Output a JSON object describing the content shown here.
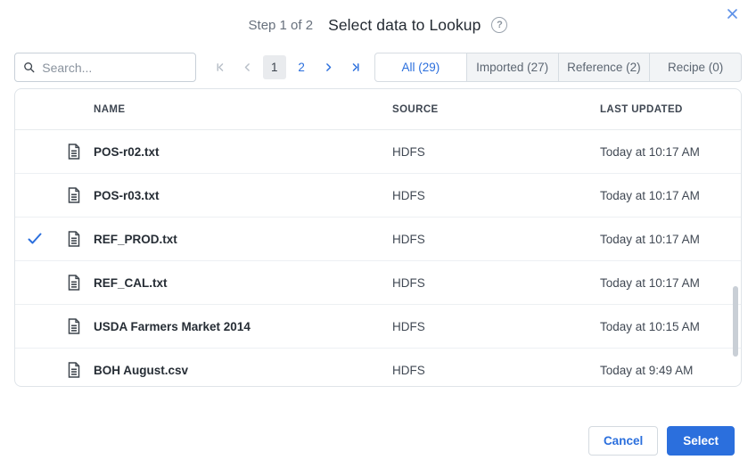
{
  "dialog": {
    "step_label": "Step 1 of 2",
    "title": "Select data to Lookup",
    "help_glyph": "?"
  },
  "search": {
    "placeholder": "Search..."
  },
  "pagination": {
    "pages": [
      {
        "label": "1",
        "current": true
      },
      {
        "label": "2",
        "current": false
      }
    ],
    "first_disabled": true,
    "prev_disabled": true
  },
  "tabs": [
    {
      "label": "All (29)",
      "active": true
    },
    {
      "label": "Imported (27)",
      "active": false
    },
    {
      "label": "Reference (2)",
      "active": false
    },
    {
      "label": "Recipe (0)",
      "active": false
    }
  ],
  "table": {
    "columns": {
      "name": "NAME",
      "source": "SOURCE",
      "last_updated": "LAST UPDATED"
    },
    "rows": [
      {
        "name": "POS-r02.txt",
        "source": "HDFS",
        "last_updated": "Today at 10:17 AM",
        "selected": false
      },
      {
        "name": "POS-r03.txt",
        "source": "HDFS",
        "last_updated": "Today at 10:17 AM",
        "selected": false
      },
      {
        "name": "REF_PROD.txt",
        "source": "HDFS",
        "last_updated": "Today at 10:17 AM",
        "selected": true
      },
      {
        "name": "REF_CAL.txt",
        "source": "HDFS",
        "last_updated": "Today at 10:17 AM",
        "selected": false
      },
      {
        "name": "USDA Farmers Market 2014",
        "source": "HDFS",
        "last_updated": "Today at 10:15 AM",
        "selected": false
      },
      {
        "name": "BOH August.csv",
        "source": "HDFS",
        "last_updated": "Today at 9:49 AM",
        "selected": false
      }
    ]
  },
  "footer": {
    "cancel_label": "Cancel",
    "select_label": "Select"
  },
  "icons": {
    "search": "magnifier",
    "file": "data-file-document",
    "check": "checkmark",
    "first_page": "bar-chevron-left",
    "prev_page": "chevron-left",
    "next_page": "chevron-right",
    "last_page": "chevron-right-bar",
    "close": "x-mark",
    "help": "question-circle"
  },
  "colors": {
    "accent_blue": "#2b6fdd",
    "close_blue": "#5f92e8",
    "disabled_gray": "#b8bfc8",
    "tab_inactive_bg": "#f2f4f6",
    "current_page_bg": "#e9ebee",
    "table_border": "#dfe4e9",
    "row_divider": "#edf0f3"
  }
}
